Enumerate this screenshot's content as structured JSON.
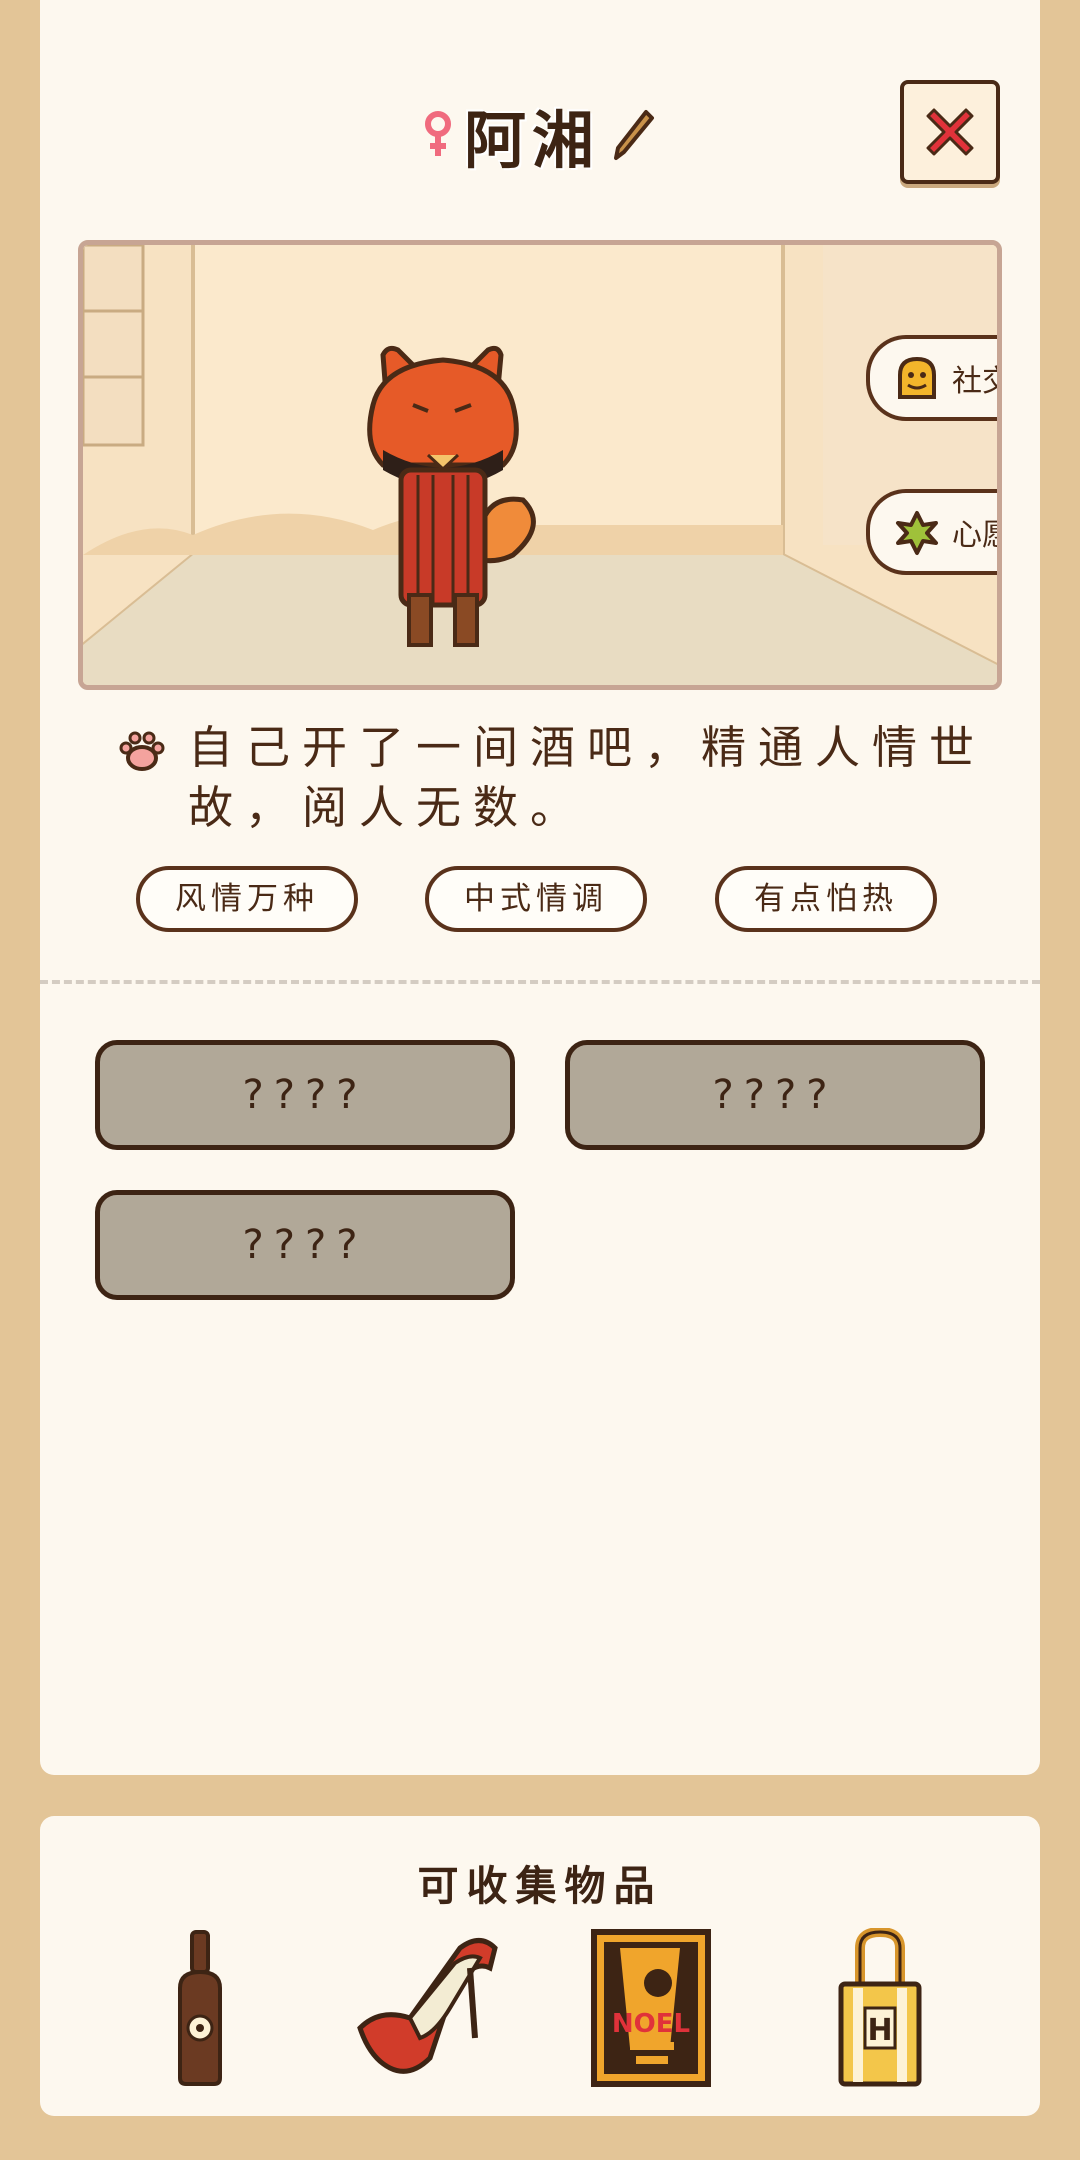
{
  "character": {
    "name": "阿湘",
    "gender": "female",
    "description": "自己开了一间酒吧，精通人情世故，阅人无数。",
    "tags": [
      "风情万种",
      "中式情调",
      "有点怕热"
    ]
  },
  "scene": {
    "side_buttons": [
      {
        "label": "社交",
        "icon": "social-icon"
      },
      {
        "label": "心愿",
        "icon": "wish-icon"
      }
    ]
  },
  "hidden_slots": [
    "????",
    "????",
    "????"
  ],
  "collectibles": {
    "title": "可收集物品",
    "items": [
      "bottle-icon",
      "high-heels-icon",
      "noel-poster-icon",
      "tote-bag-icon"
    ]
  },
  "colors": {
    "background": "#e3c597",
    "card": "#fdf8ef",
    "outline": "#4a2a16",
    "locked_slot": "#b1a898",
    "close_x": "#e0323a"
  }
}
